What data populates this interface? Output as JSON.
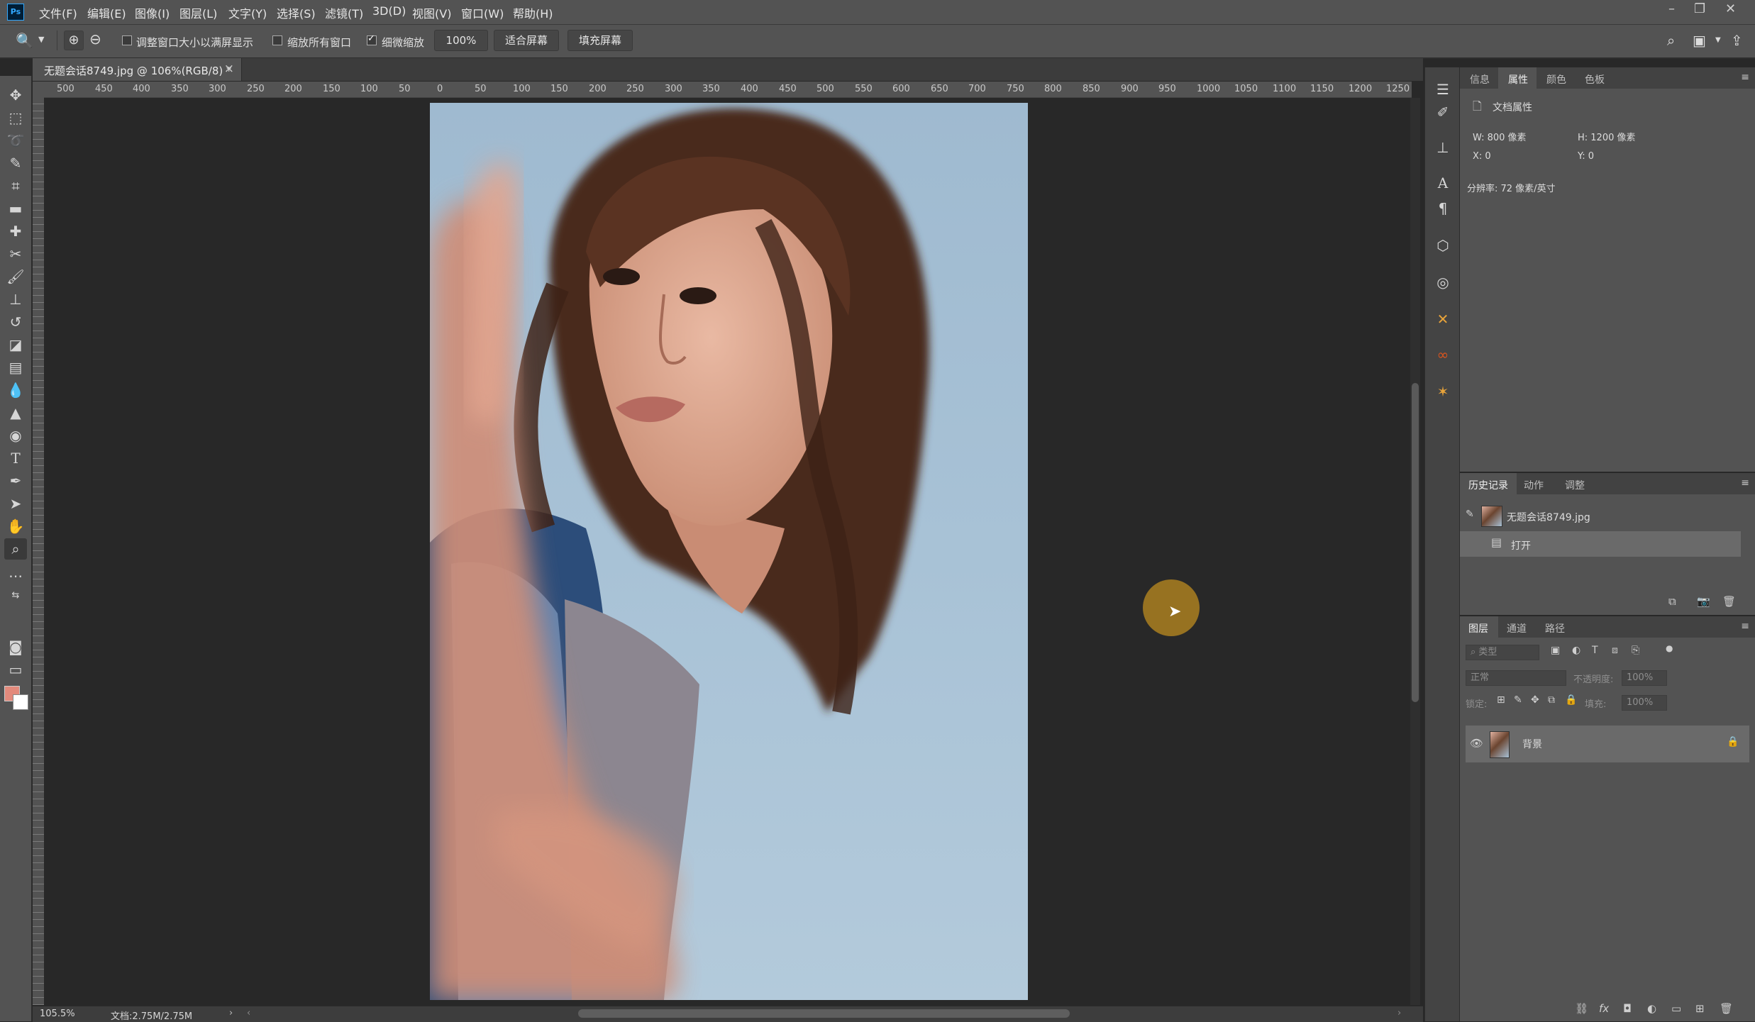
{
  "app": {
    "logo": "Ps"
  },
  "menu": [
    "文件(F)",
    "编辑(E)",
    "图像(I)",
    "图层(L)",
    "文字(Y)",
    "选择(S)",
    "滤镜(T)",
    "3D(D)",
    "视图(V)",
    "窗口(W)",
    "帮助(H)"
  ],
  "options": {
    "resize_windows_label": "调整窗口大小以满屏显示",
    "resize_windows_checked": false,
    "zoom_all_label": "缩放所有窗口",
    "zoom_all_checked": false,
    "scrubby_zoom_label": "细微缩放",
    "scrubby_zoom_checked": true,
    "zoom_value": "100%",
    "fit_screen": "适合屏幕",
    "fill_screen": "填充屏幕"
  },
  "document": {
    "tab_title": "无题会话8749.jpg @ 106%(RGB/8) *",
    "close_glyph": "×",
    "ruler_labels": [
      "500",
      "450",
      "400",
      "350",
      "300",
      "250",
      "200",
      "150",
      "100",
      "50",
      "0",
      "50",
      "100",
      "150",
      "200",
      "250",
      "300",
      "350",
      "400",
      "450",
      "500",
      "550",
      "600",
      "650",
      "700",
      "750",
      "800",
      "850",
      "900",
      "950",
      "1000",
      "1050",
      "1100",
      "1150",
      "1200",
      "1250"
    ]
  },
  "status": {
    "zoom": "105.5%",
    "doc_size": "文档:2.75M/2.75M"
  },
  "properties_panel": {
    "tabs": [
      "信息",
      "属性",
      "颜色",
      "色板"
    ],
    "active_tab": "属性",
    "section_title": "文档属性",
    "width": "W:  800 像素",
    "height": "H:  1200 像素",
    "x": "X:  0",
    "y": "Y:  0",
    "resolution": "分辨率: 72 像素/英寸"
  },
  "history_panel": {
    "tabs": [
      "历史记录",
      "动作",
      "调整"
    ],
    "active_tab": "历史记录",
    "snapshot": "无题会话8749.jpg",
    "items": [
      "打开"
    ]
  },
  "layers_panel": {
    "tabs": [
      "图层",
      "通道",
      "路径"
    ],
    "active_tab": "图层",
    "filter_placeholder": "类型",
    "blend_mode": "正常",
    "opacity_label": "不透明度:",
    "opacity_value": "100%",
    "lock_label": "锁定:",
    "fill_label": "填充:",
    "fill_value": "100%",
    "layers": [
      {
        "name": "背景",
        "visible": true,
        "locked": true
      }
    ]
  },
  "colors": {
    "foreground": "#e38a7c",
    "background": "#ffffff",
    "cursor_highlight": "#a37a20"
  }
}
